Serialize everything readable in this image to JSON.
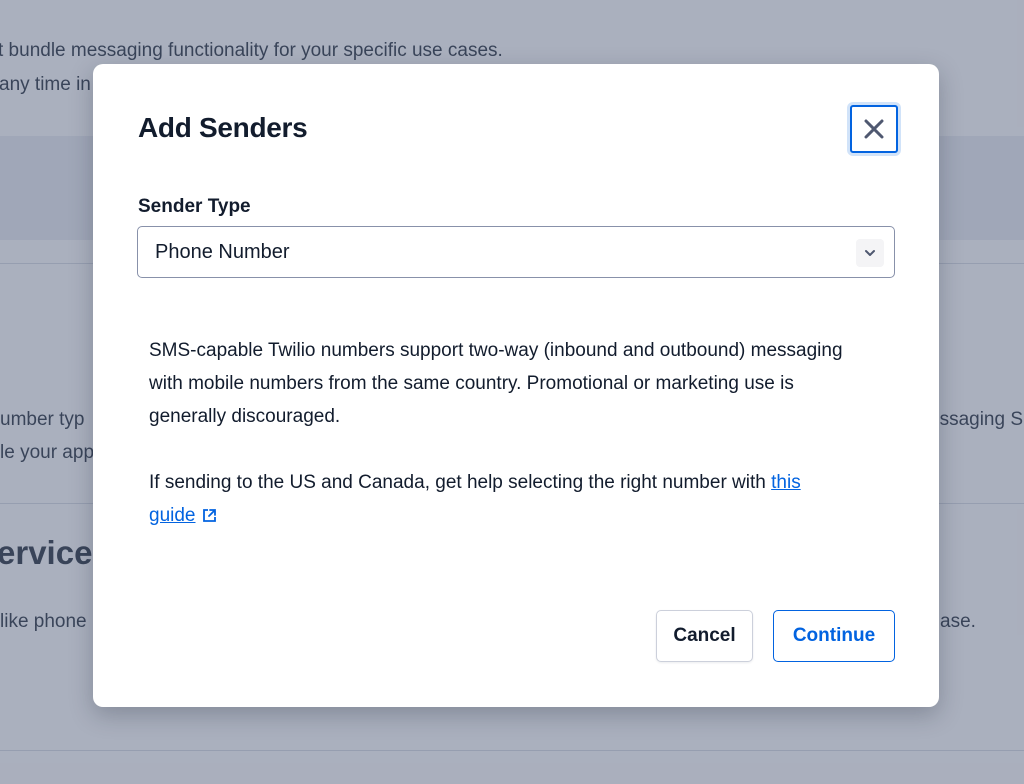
{
  "background": {
    "line1": "t bundle messaging functionality for your specific use cases.",
    "line2": "any time in",
    "line3_left": "umber typ",
    "line3_right": "essaging S",
    "line4_left": "le your app",
    "heading": "ervice",
    "line5_left": "like phone",
    "line5_right": "ase."
  },
  "modal": {
    "title": "Add Senders",
    "close_icon": "close-icon",
    "field_label": "Sender Type",
    "select_value": "Phone Number",
    "select_icon": "chevron-down-icon",
    "description_1": "SMS-capable Twilio numbers support two-way (inbound and outbound) messaging with mobile numbers from the same country. Promotional or marketing use is generally discouraged.",
    "description_2_prefix": "If sending to the US and Canada, get help selecting the right number with ",
    "link_text": "this guide",
    "link_icon": "external-link-icon",
    "cancel_label": "Cancel",
    "continue_label": "Continue"
  },
  "colors": {
    "link": "#0263e0",
    "text": "#121c2d",
    "overlay": "rgba(96,107,133,0.5)"
  }
}
